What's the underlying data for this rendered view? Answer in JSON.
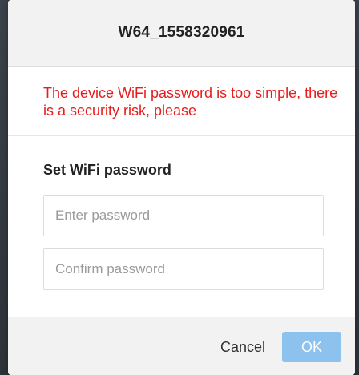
{
  "dialog": {
    "title": "W64_1558320961",
    "warning": "The device WiFi password is too simple, there is a security risk, please",
    "section_label": "Set WiFi password",
    "password_placeholder": "Enter password",
    "password_value": "",
    "confirm_placeholder": "Confirm password",
    "confirm_value": "",
    "cancel_label": "Cancel",
    "ok_label": "OK"
  },
  "colors": {
    "warning": "#e81c1c",
    "ok_button": "#8ec2ee",
    "header_bg": "#f2f2f2"
  }
}
